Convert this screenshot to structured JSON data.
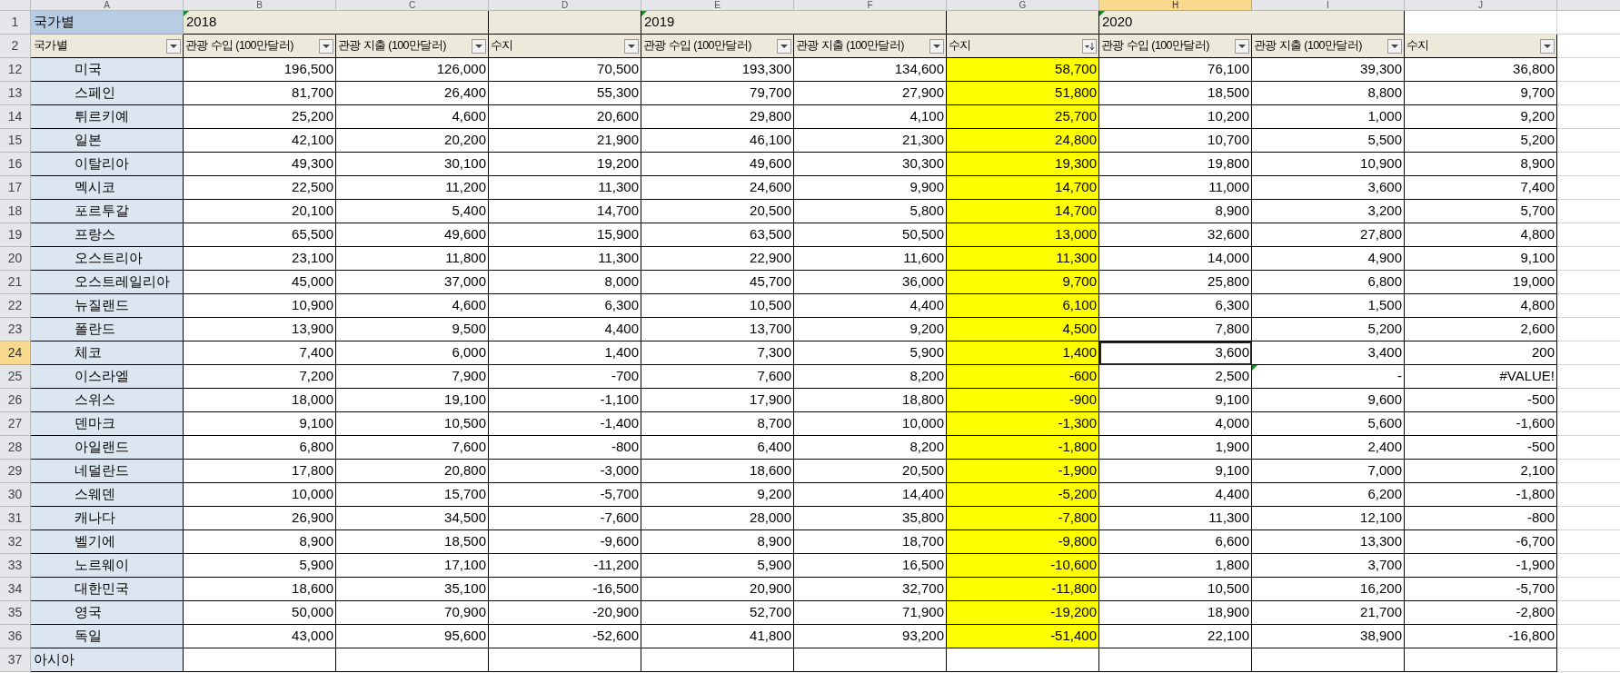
{
  "columns": [
    {
      "letter": "A",
      "selected": false,
      "highlighted": false
    },
    {
      "letter": "B",
      "selected": false,
      "highlighted": false
    },
    {
      "letter": "C",
      "selected": false,
      "highlighted": false
    },
    {
      "letter": "D",
      "selected": false,
      "highlighted": false
    },
    {
      "letter": "E",
      "selected": false,
      "highlighted": false
    },
    {
      "letter": "F",
      "selected": false,
      "highlighted": false
    },
    {
      "letter": "G",
      "selected": false,
      "highlighted": true
    },
    {
      "letter": "H",
      "selected": true,
      "highlighted": false
    },
    {
      "letter": "I",
      "selected": false,
      "highlighted": false
    },
    {
      "letter": "J",
      "selected": false,
      "highlighted": false
    }
  ],
  "group_row": {
    "number": "1",
    "label": "국가별",
    "groups": [
      {
        "year": "2018"
      },
      {
        "year": "2019"
      },
      {
        "year": "2020"
      }
    ]
  },
  "header_row": {
    "number": "2",
    "headers": [
      {
        "text": "국가별",
        "filter": true,
        "sorted_descending": false
      },
      {
        "text": "관광 수입 (100만달러)",
        "filter": true,
        "sorted_descending": false
      },
      {
        "text": "관광 지출 (100만달러)",
        "filter": true,
        "sorted_descending": false
      },
      {
        "text": "수지",
        "filter": true,
        "sorted_descending": false
      },
      {
        "text": "관광 수입 (100만달러)",
        "filter": true,
        "sorted_descending": false
      },
      {
        "text": "관광 지출 (100만달러)",
        "filter": true,
        "sorted_descending": false
      },
      {
        "text": "수지",
        "filter": true,
        "sorted_descending": true
      },
      {
        "text": "관광 수입 (100만달러)",
        "filter": true,
        "sorted_descending": false
      },
      {
        "text": "관광 지출 (100만달러)",
        "filter": true,
        "sorted_descending": false
      },
      {
        "text": "수지",
        "filter": true,
        "sorted_descending": false
      }
    ]
  },
  "rows": [
    {
      "number": "12",
      "kind": "country",
      "selected": false,
      "name": "미국",
      "values": [
        "196,500",
        "126,000",
        "70,500",
        "193,300",
        "134,600",
        "58,700",
        "76,100",
        "39,300",
        "36,800"
      ]
    },
    {
      "number": "13",
      "kind": "country",
      "selected": false,
      "name": "스페인",
      "values": [
        "81,700",
        "26,400",
        "55,300",
        "79,700",
        "27,900",
        "51,800",
        "18,500",
        "8,800",
        "9,700"
      ]
    },
    {
      "number": "14",
      "kind": "country",
      "selected": false,
      "name": "튀르키예",
      "values": [
        "25,200",
        "4,600",
        "20,600",
        "29,800",
        "4,100",
        "25,700",
        "10,200",
        "1,000",
        "9,200"
      ]
    },
    {
      "number": "15",
      "kind": "country",
      "selected": false,
      "name": "일본",
      "values": [
        "42,100",
        "20,200",
        "21,900",
        "46,100",
        "21,300",
        "24,800",
        "10,700",
        "5,500",
        "5,200"
      ]
    },
    {
      "number": "16",
      "kind": "country",
      "selected": false,
      "name": "이탈리아",
      "values": [
        "49,300",
        "30,100",
        "19,200",
        "49,600",
        "30,300",
        "19,300",
        "19,800",
        "10,900",
        "8,900"
      ]
    },
    {
      "number": "17",
      "kind": "country",
      "selected": false,
      "name": "멕시코",
      "values": [
        "22,500",
        "11,200",
        "11,300",
        "24,600",
        "9,900",
        "14,700",
        "11,000",
        "3,600",
        "7,400"
      ]
    },
    {
      "number": "18",
      "kind": "country",
      "selected": false,
      "name": "포르투갈",
      "values": [
        "20,100",
        "5,400",
        "14,700",
        "20,500",
        "5,800",
        "14,700",
        "8,900",
        "3,200",
        "5,700"
      ]
    },
    {
      "number": "19",
      "kind": "country",
      "selected": false,
      "name": "프랑스",
      "values": [
        "65,500",
        "49,600",
        "15,900",
        "63,500",
        "50,500",
        "13,000",
        "32,600",
        "27,800",
        "4,800"
      ]
    },
    {
      "number": "20",
      "kind": "country",
      "selected": false,
      "name": "오스트리아",
      "values": [
        "23,100",
        "11,800",
        "11,300",
        "22,900",
        "11,600",
        "11,300",
        "14,000",
        "4,900",
        "9,100"
      ]
    },
    {
      "number": "21",
      "kind": "country",
      "selected": false,
      "name": "오스트레일리아",
      "values": [
        "45,000",
        "37,000",
        "8,000",
        "45,700",
        "36,000",
        "9,700",
        "25,800",
        "6,800",
        "19,000"
      ]
    },
    {
      "number": "22",
      "kind": "country",
      "selected": false,
      "name": "뉴질랜드",
      "values": [
        "10,900",
        "4,600",
        "6,300",
        "10,500",
        "4,400",
        "6,100",
        "6,300",
        "1,500",
        "4,800"
      ]
    },
    {
      "number": "23",
      "kind": "country",
      "selected": false,
      "name": "폴란드",
      "values": [
        "13,900",
        "9,500",
        "4,400",
        "13,700",
        "9,200",
        "4,500",
        "7,800",
        "5,200",
        "2,600"
      ]
    },
    {
      "number": "24",
      "kind": "country",
      "selected": true,
      "name": "체코",
      "values": [
        "7,400",
        "6,000",
        "1,400",
        "7,300",
        "5,900",
        "1,400",
        "3,600",
        "3,400",
        "200"
      ]
    },
    {
      "number": "25",
      "kind": "country",
      "selected": false,
      "name": "이스라엘",
      "error_marks": [
        false,
        false,
        false,
        false,
        false,
        false,
        false,
        true,
        false
      ],
      "values": [
        "7,200",
        "7,900",
        "-700",
        "7,600",
        "8,200",
        "-600",
        "2,500",
        "-",
        "#VALUE!"
      ]
    },
    {
      "number": "26",
      "kind": "country",
      "selected": false,
      "name": "스위스",
      "values": [
        "18,000",
        "19,100",
        "-1,100",
        "17,900",
        "18,800",
        "-900",
        "9,100",
        "9,600",
        "-500"
      ]
    },
    {
      "number": "27",
      "kind": "country",
      "selected": false,
      "name": "덴마크",
      "values": [
        "9,100",
        "10,500",
        "-1,400",
        "8,700",
        "10,000",
        "-1,300",
        "4,000",
        "5,600",
        "-1,600"
      ]
    },
    {
      "number": "28",
      "kind": "country",
      "selected": false,
      "name": "아일랜드",
      "values": [
        "6,800",
        "7,600",
        "-800",
        "6,400",
        "8,200",
        "-1,800",
        "1,900",
        "2,400",
        "-500"
      ]
    },
    {
      "number": "29",
      "kind": "country",
      "selected": false,
      "name": "네덜란드",
      "values": [
        "17,800",
        "20,800",
        "-3,000",
        "18,600",
        "20,500",
        "-1,900",
        "9,100",
        "7,000",
        "2,100"
      ]
    },
    {
      "number": "30",
      "kind": "country",
      "selected": false,
      "name": "스웨덴",
      "values": [
        "10,000",
        "15,700",
        "-5,700",
        "9,200",
        "14,400",
        "-5,200",
        "4,400",
        "6,200",
        "-1,800"
      ]
    },
    {
      "number": "31",
      "kind": "country",
      "selected": false,
      "name": "캐나다",
      "values": [
        "26,900",
        "34,500",
        "-7,600",
        "28,000",
        "35,800",
        "-7,800",
        "11,300",
        "12,100",
        "-800"
      ]
    },
    {
      "number": "32",
      "kind": "country",
      "selected": false,
      "name": "벨기에",
      "values": [
        "8,900",
        "18,500",
        "-9,600",
        "8,900",
        "18,700",
        "-9,800",
        "6,600",
        "13,300",
        "-6,700"
      ]
    },
    {
      "number": "33",
      "kind": "country",
      "selected": false,
      "name": "노르웨이",
      "values": [
        "5,900",
        "17,100",
        "-11,200",
        "5,900",
        "16,500",
        "-10,600",
        "1,800",
        "3,700",
        "-1,900"
      ]
    },
    {
      "number": "34",
      "kind": "country",
      "selected": false,
      "name": "대한민국",
      "values": [
        "18,600",
        "35,100",
        "-16,500",
        "20,900",
        "32,700",
        "-11,800",
        "10,500",
        "16,200",
        "-5,700"
      ]
    },
    {
      "number": "35",
      "kind": "country",
      "selected": false,
      "name": "영국",
      "values": [
        "50,000",
        "70,900",
        "-20,900",
        "52,700",
        "71,900",
        "-19,200",
        "18,900",
        "21,700",
        "-2,800"
      ]
    },
    {
      "number": "36",
      "kind": "country",
      "selected": false,
      "name": "독일",
      "values": [
        "43,000",
        "95,600",
        "-52,600",
        "41,800",
        "93,200",
        "-51,400",
        "22,100",
        "38,900",
        "-16,800"
      ]
    },
    {
      "number": "37",
      "kind": "region",
      "selected": false,
      "name": "아시아"
    }
  ]
}
